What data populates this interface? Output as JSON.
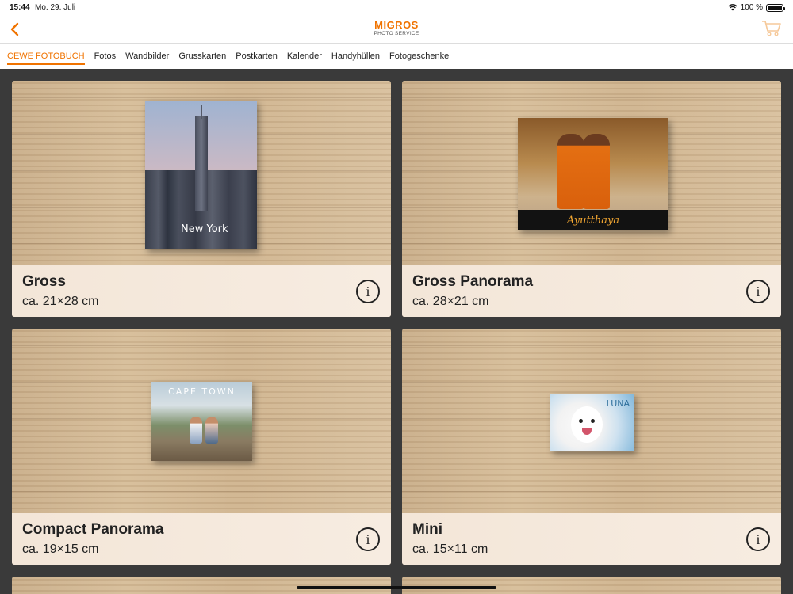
{
  "status_bar": {
    "time": "15:44",
    "date": "Mo. 29. Juli",
    "battery": "100 %"
  },
  "header": {
    "brand": "MIGROS",
    "brand_sub": "PHOTO SERVICE",
    "accent": "#f07300"
  },
  "tabs": [
    {
      "label": "CEWE FOTOBUCH",
      "active": true
    },
    {
      "label": "Fotos"
    },
    {
      "label": "Wandbilder"
    },
    {
      "label": "Grusskarten"
    },
    {
      "label": "Postkarten"
    },
    {
      "label": "Kalender"
    },
    {
      "label": "Handyhüllen"
    },
    {
      "label": "Fotogeschenke"
    }
  ],
  "products": [
    {
      "title": "Gross",
      "size": "ca. 21×28 cm",
      "cover_text": "New York"
    },
    {
      "title": "Gross Panorama",
      "size": "ca. 28×21 cm",
      "cover_text": "Ayutthaya"
    },
    {
      "title": "Compact Panorama",
      "size": "ca. 19×15 cm",
      "cover_text": "CAPE TOWN"
    },
    {
      "title": "Mini",
      "size": "ca. 15×11 cm",
      "cover_text": "LUNA"
    }
  ],
  "info_icon": "i"
}
